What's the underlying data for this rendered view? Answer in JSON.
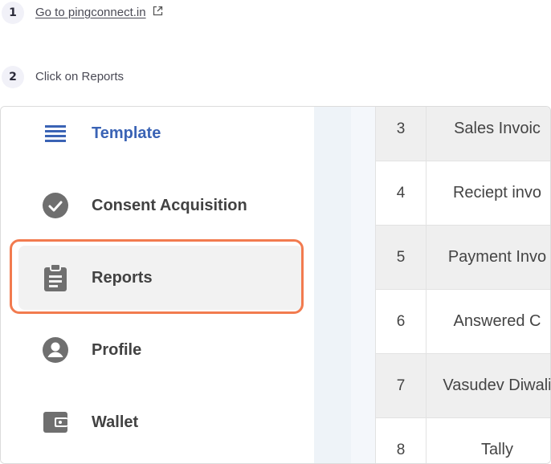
{
  "steps": [
    {
      "number": "1",
      "text": "Go to pingconnect.in",
      "icon": "external-link-icon"
    },
    {
      "number": "2",
      "text": "Click on Reports"
    }
  ],
  "sidebar": {
    "items": [
      {
        "label": "Template",
        "icon": "list-icon",
        "state": "active"
      },
      {
        "label": "Consent Acquisition",
        "icon": "check-circle-icon"
      },
      {
        "label": "Reports",
        "icon": "clipboard-icon",
        "state": "highlighted"
      },
      {
        "label": "Profile",
        "icon": "user-circle-icon"
      },
      {
        "label": "Wallet",
        "icon": "wallet-icon"
      }
    ]
  },
  "table": {
    "rows": [
      {
        "num": "3",
        "name": "Sales Invoic"
      },
      {
        "num": "4",
        "name": "Reciept invo"
      },
      {
        "num": "5",
        "name": "Payment Invo"
      },
      {
        "num": "6",
        "name": "Answered C"
      },
      {
        "num": "7",
        "name": "Vasudev Diwali"
      },
      {
        "num": "8",
        "name": "Tally"
      }
    ]
  },
  "colors": {
    "active_text": "#3a63b5",
    "highlight_border": "#f27b4f",
    "icon_grey": "#6f6f6f"
  }
}
